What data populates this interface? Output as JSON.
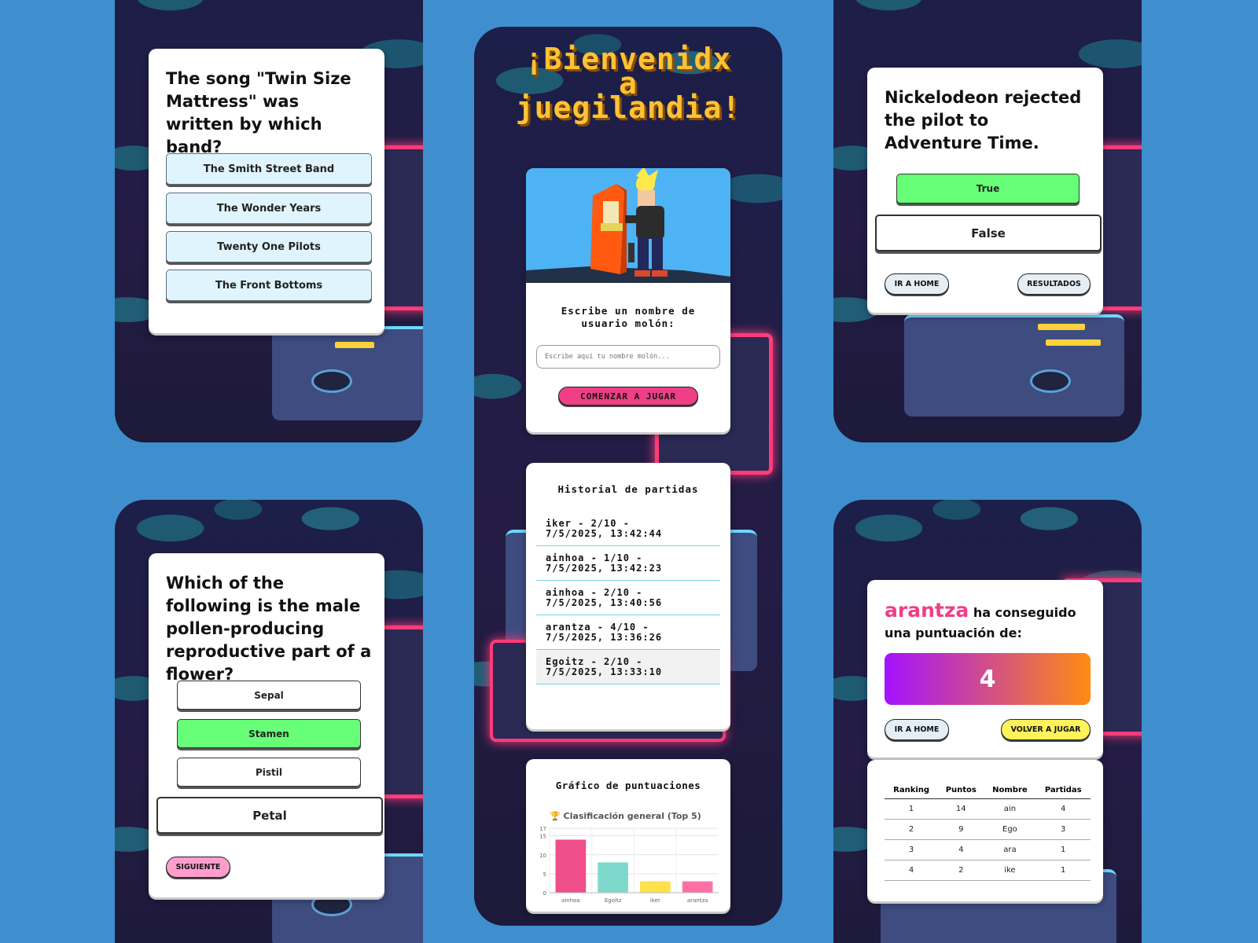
{
  "quiz_band": {
    "question": "The song \"Twin Size Mattress\" was written by which band?",
    "options": [
      "The Smith Street Band",
      "The Wonder Years",
      "Twenty One Pilots",
      "The Front Bottoms"
    ]
  },
  "welcome": {
    "title_line1": "¡Bienvenidx",
    "title_line2": "a",
    "title_line3": "juegilandia!",
    "prompt": "Escribe un nombre de usuario molón:",
    "input_placeholder": "Escribe aquí tu nombre molón...",
    "start_button": "COMENZAR A JUGAR"
  },
  "history": {
    "title": "Historial de partidas",
    "entries": [
      {
        "line1": "iker - 2/10 -",
        "line2": "7/5/2025, 13:42:44"
      },
      {
        "line1": "ainhoa - 1/10 -",
        "line2": "7/5/2025, 13:42:23"
      },
      {
        "line1": "ainhoa - 2/10 -",
        "line2": "7/5/2025, 13:40:56"
      },
      {
        "line1": "arantza - 4/10 -",
        "line2": "7/5/2025, 13:36:26"
      },
      {
        "line1": "Egoitz - 2/10 -",
        "line2": "7/5/2025, 13:33:10"
      }
    ]
  },
  "chart_card": {
    "title": "Gráfico de puntuaciones"
  },
  "chart_data": {
    "type": "bar",
    "title": "Clasificación general (Top 5)",
    "categories": [
      "ainhoa",
      "Egoitz",
      "iker",
      "arantza"
    ],
    "values": [
      14,
      8,
      3,
      3
    ],
    "colors": [
      "#ef4f8b",
      "#7fd8cc",
      "#ffe14a",
      "#ff6fa6"
    ],
    "ylim": [
      0,
      17
    ],
    "yticks": [
      0,
      5,
      10,
      15,
      17
    ],
    "title_icon": "trophy-icon"
  },
  "quiz_tf": {
    "question": "Nickelodeon rejected the pilot to Adventure Time.",
    "true_label": "True",
    "false_label": "False",
    "home_button": "IR A HOME",
    "results_button": "RESULTADOS"
  },
  "quiz_flower": {
    "question": "Which of the following is the male pollen-producing reproductive part of a flower?",
    "options": [
      "Sepal",
      "Stamen",
      "Pistil",
      "Petal"
    ],
    "next_button": "SIGUIENTE"
  },
  "result": {
    "username": "arantza",
    "text_after_name": " ha conseguido",
    "text_line2": "una puntuación de:",
    "score": "4",
    "home_button": "IR A HOME",
    "replay_button": "VOLVER A JUGAR"
  },
  "ranking": {
    "headers": [
      "Ranking",
      "Puntos",
      "Nombre",
      "Partidas"
    ],
    "rows": [
      [
        "1",
        "14",
        "ain",
        "4"
      ],
      [
        "2",
        "9",
        "Ego",
        "3"
      ],
      [
        "3",
        "4",
        "ara",
        "1"
      ],
      [
        "4",
        "2",
        "ike",
        "1"
      ]
    ]
  },
  "colors": {
    "background": "#3f8fcf",
    "correct_green": "#66ff77",
    "accent_pink": "#ef3f86",
    "title_yellow": "#ffc233",
    "score_gradient_start": "#a312ff",
    "score_gradient_end": "#ff8c12"
  }
}
